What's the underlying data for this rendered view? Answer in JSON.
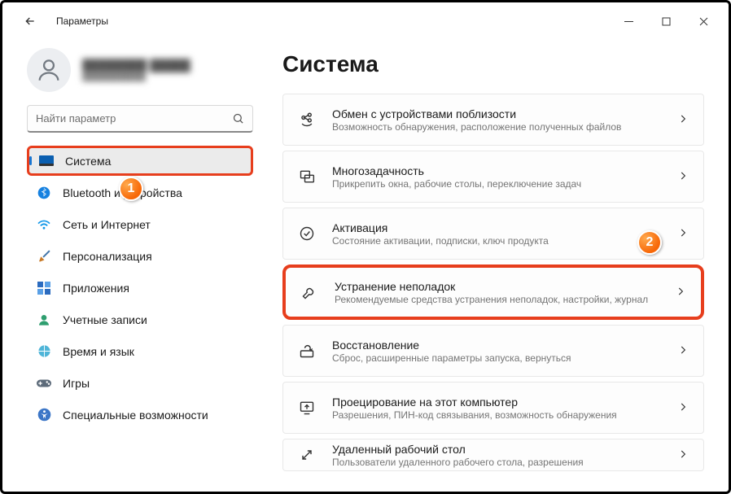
{
  "window": {
    "title": "Параметры"
  },
  "profile": {
    "name": "████████ █████",
    "mail": "██████████"
  },
  "search": {
    "placeholder": "Найти параметр"
  },
  "sidebar": {
    "items": [
      {
        "label": "Система"
      },
      {
        "label": "Bluetooth и устройства"
      },
      {
        "label": "Сеть и Интернет"
      },
      {
        "label": "Персонализация"
      },
      {
        "label": "Приложения"
      },
      {
        "label": "Учетные записи"
      },
      {
        "label": "Время и язык"
      },
      {
        "label": "Игры"
      },
      {
        "label": "Специальные возможности"
      }
    ]
  },
  "main": {
    "heading": "Система",
    "cards": [
      {
        "title": "Обмен с устройствами поблизости",
        "sub": "Возможность обнаружения, расположение полученных файлов"
      },
      {
        "title": "Многозадачность",
        "sub": "Прикрепить окна, рабочие столы, переключение задач"
      },
      {
        "title": "Активация",
        "sub": "Состояние активации, подписки, ключ продукта"
      },
      {
        "title": "Устранение неполадок",
        "sub": "Рекомендуемые средства устранения неполадок, настройки, журнал"
      },
      {
        "title": "Восстановление",
        "sub": "Сброс, расширенные параметры запуска, вернуться"
      },
      {
        "title": "Проецирование на этот компьютер",
        "sub": "Разрешения, ПИН-код связывания, возможность обнаружения"
      },
      {
        "title": "Удаленный рабочий стол",
        "sub": "Пользователи удаленного рабочего стола, разрешения"
      }
    ]
  },
  "badges": {
    "one": "1",
    "two": "2"
  },
  "colors": {
    "accent": "#1976d2",
    "highlight": "#e73e1d"
  }
}
